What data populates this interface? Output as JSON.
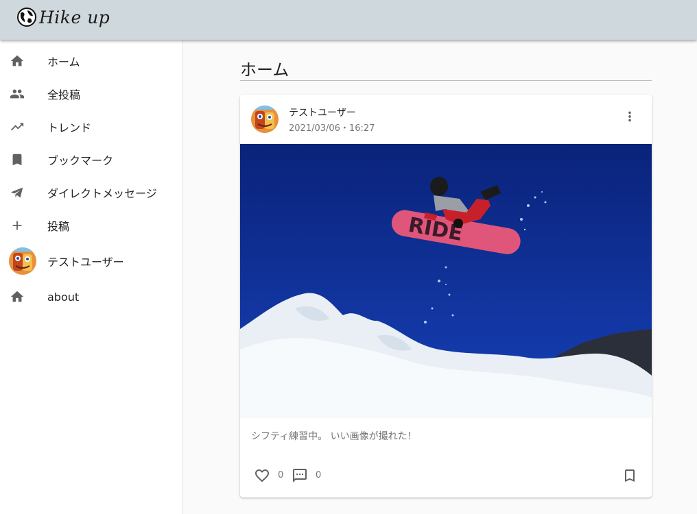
{
  "app": {
    "brand": "Hike up"
  },
  "sidebar": {
    "items": [
      {
        "label": "ホーム",
        "icon": "home-icon"
      },
      {
        "label": "全投稿",
        "icon": "people-icon"
      },
      {
        "label": "トレンド",
        "icon": "trending-up-icon"
      },
      {
        "label": "ブックマーク",
        "icon": "bookmark-icon"
      },
      {
        "label": "ダイレクトメッセージ",
        "icon": "send-icon"
      },
      {
        "label": "投稿",
        "icon": "plus-icon"
      },
      {
        "label": "テストユーザー",
        "icon": "avatar"
      },
      {
        "label": "about",
        "icon": "home-icon"
      }
    ]
  },
  "main": {
    "title": "ホーム"
  },
  "post": {
    "user": "テストユーザー",
    "date": "2021/03/06・16:27",
    "text": "シフティ練習中。 いい画像が撮れた！",
    "image_alt": "snowboarder-jump-photo",
    "likes": "0",
    "comments": "0"
  },
  "colors": {
    "appbar": "#cfd8dc",
    "sky": "#0f2a86",
    "snow": "#eef3f7",
    "board": "#e0567a"
  }
}
